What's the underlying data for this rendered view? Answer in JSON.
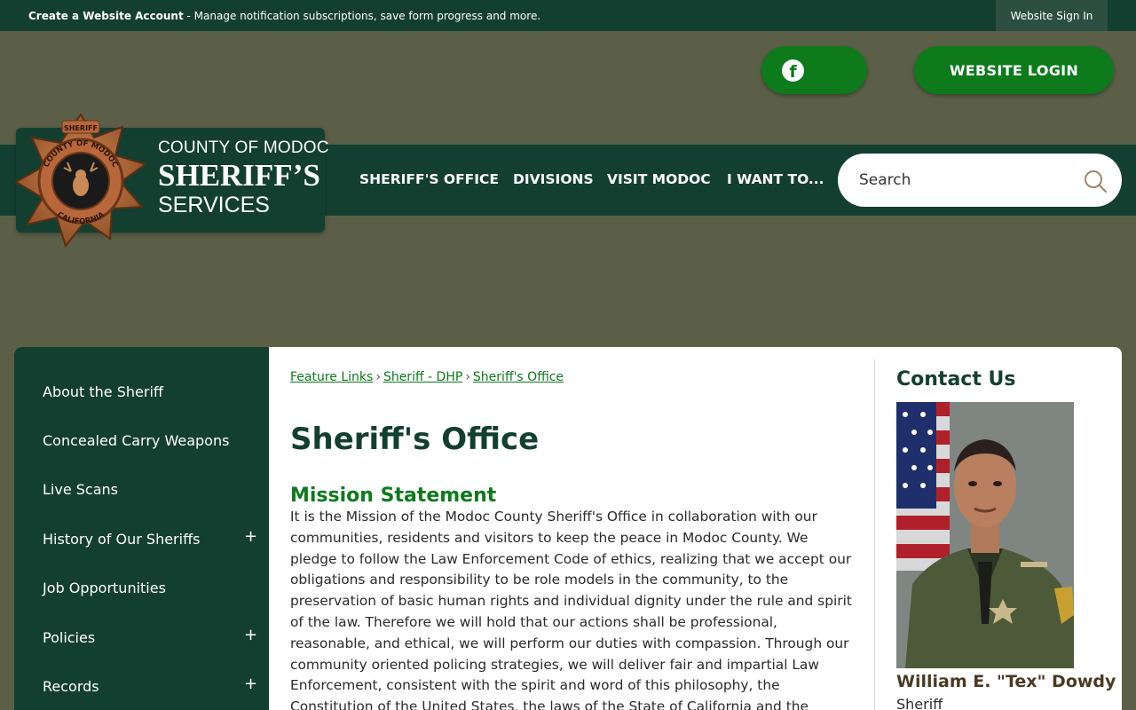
{
  "topbar": {
    "create_account_bold": "Create a Website Account",
    "create_account_rest": " - Manage notification subscriptions, save form progress and more.",
    "sign_in": "Website Sign In"
  },
  "social": {
    "facebook_icon": "facebook-icon",
    "facebook_glyph": "f",
    "login_label": "WEBSITE LOGIN"
  },
  "logo": {
    "line1": "COUNTY OF MODOC",
    "line2": "SHERIFF’S",
    "line3": "SERVICES",
    "badge_top": "SHERIFF",
    "badge_ring_top": "COUNTY OF MODOC",
    "badge_ring_bottom": "CALIFORNIA"
  },
  "nav": {
    "items": [
      "SHERIFF'S OFFICE",
      "DIVISIONS",
      "VISIT MODOC",
      "I WANT TO..."
    ]
  },
  "search": {
    "placeholder": "Search"
  },
  "sidebar": {
    "items": [
      {
        "label": "About the Sheriff",
        "expandable": false
      },
      {
        "label": "Concealed Carry Weapons",
        "expandable": false
      },
      {
        "label": "Live Scans",
        "expandable": false
      },
      {
        "label": "History of Our Sheriffs",
        "expandable": true
      },
      {
        "label": "Job Opportunities",
        "expandable": false
      },
      {
        "label": "Policies",
        "expandable": true
      },
      {
        "label": "Records",
        "expandable": true
      }
    ],
    "plus": "+"
  },
  "breadcrumb": {
    "items": [
      "Feature Links",
      "Sheriff - DHP",
      "Sheriff's Office"
    ],
    "separator": "›"
  },
  "main": {
    "title": "Sheriff's Office",
    "mission_heading": "Mission Statement",
    "mission_body": "It is the Mission of the Modoc County Sheriff's Office in collaboration with our communities, residents and visitors to keep the peace in Modoc County. We pledge to follow the Law Enforcement Code of ethics, realizing that we accept our obligations and responsibility to be role models in the community, to the preservation of basic human rights and individual dignity under the rule and spirit of the law. Therefore we will hold that our actions shall be professional, reasonable, and ethical, we will perform our duties with compassion. Through our community oriented policing strategies, we will deliver fair and impartial Law Enforcement, consistent with the spirit and word of this philosophy, the Constitution of the United States, the laws of the State of California and the Ordinances of Modoc County."
  },
  "contact": {
    "title": "Contact Us",
    "name": "William E. \"Tex\" Dowdy",
    "role": "Sheriff"
  },
  "colors": {
    "dark_green": "#133f31",
    "accent_green": "#0d7a1c",
    "olive_bg": "#5b5f47"
  }
}
